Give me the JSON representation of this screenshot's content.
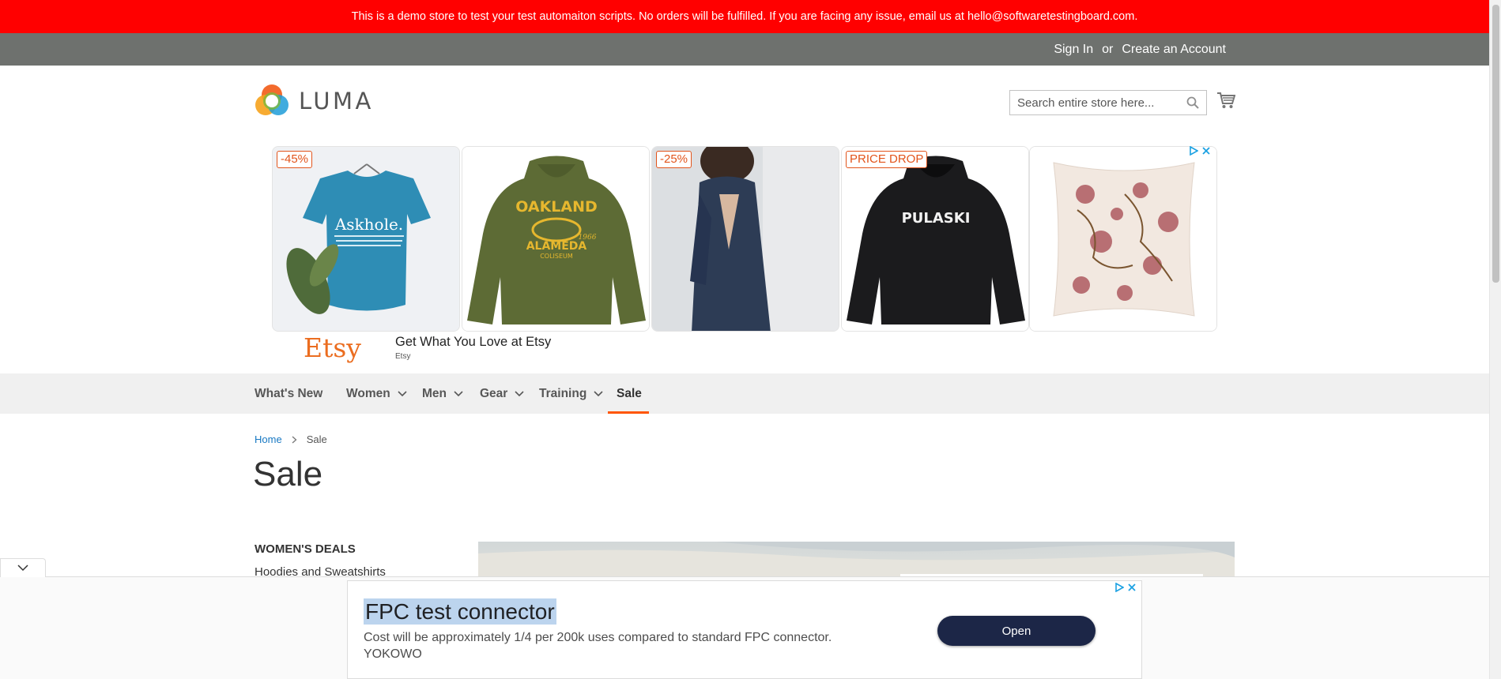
{
  "notice": {
    "text": "This is a demo store to test your test automaiton scripts. No orders will be fulfilled. If you are facing any issue, email us at hello@softwaretestingboard.com."
  },
  "header": {
    "sign_in": "Sign In",
    "or": "or",
    "create_account": "Create an Account"
  },
  "logo": {
    "text": "LUMA"
  },
  "search": {
    "placeholder": "Search entire store here..."
  },
  "ad_banner": {
    "badges": [
      "-45%",
      "-25%",
      "PRICE DROP"
    ],
    "shirt_text": "Askhole.",
    "hoodie1_line1": "OAKLAND",
    "hoodie1_line2": "ALAMEDA",
    "hoodie1_line3": "COLISEUM",
    "hoodie1_year": "1966",
    "hoodie2_text": "PULASKI",
    "advertiser_logo": "Etsy",
    "headline": "Get What You Love at Etsy",
    "advertiser": "Etsy"
  },
  "nav": {
    "items": [
      {
        "label": "What's New"
      },
      {
        "label": "Women"
      },
      {
        "label": "Men"
      },
      {
        "label": "Gear"
      },
      {
        "label": "Training"
      },
      {
        "label": "Sale"
      }
    ]
  },
  "breadcrumb": {
    "home": "Home",
    "current": "Sale"
  },
  "page_title": "Sale",
  "sidebar": {
    "heading": "Women's Deals",
    "link": "Hoodies and Sweatshirts"
  },
  "bottom_ad": {
    "title": "FPC test connector",
    "description": "Cost will be approximately 1/4 per 200k uses compared to standard FPC connector.",
    "advertiser": "YOKOWO",
    "button": "Open"
  },
  "colors": {
    "notice_bg": "#ff0000",
    "header_bg": "#6e716e",
    "nav_active": "#ff5501",
    "link": "#1979c3",
    "ad_button": "#1c2647"
  }
}
